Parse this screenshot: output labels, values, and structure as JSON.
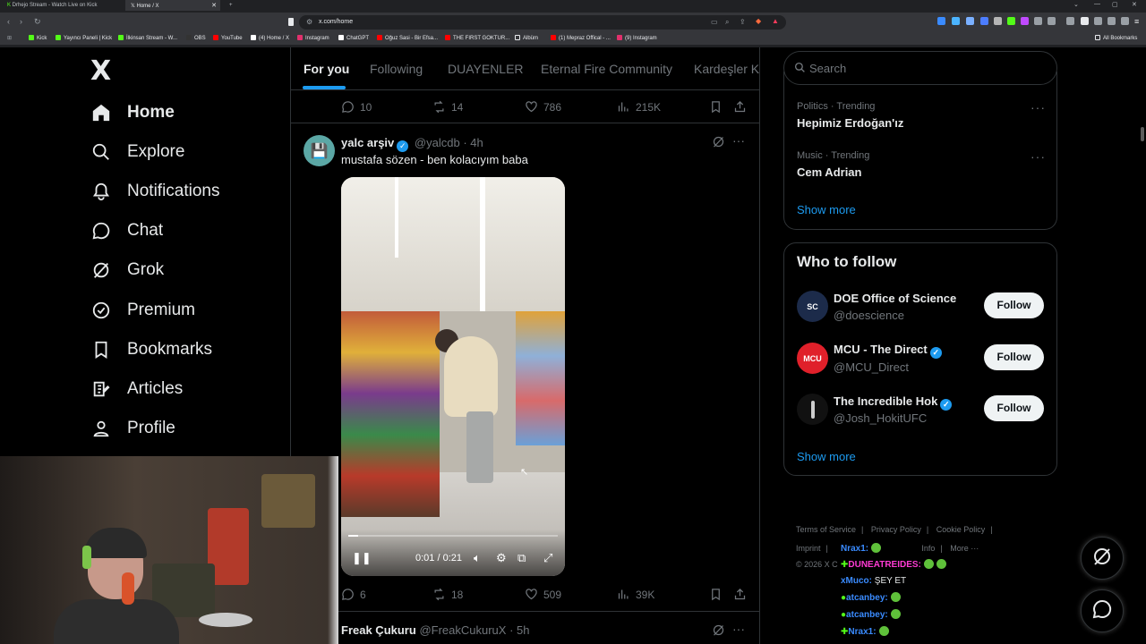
{
  "browser": {
    "tabs": [
      {
        "title": "Drhejo Stream - Watch Live on Kick"
      },
      {
        "title": "Home / X",
        "active": true
      }
    ],
    "url": "x.com/home",
    "bookmarks": [
      "Kick",
      "Yayıncı Paneli | Kick",
      "İlkinsan Stream - W...",
      "OBS",
      "YouTube",
      "(4) Home / X",
      "Instagram",
      "ChatGPT",
      "Oğuz Sasi - Bir Efsa...",
      "THE FIRST GOKTUR...",
      "Albüm",
      "(1) Mepraz Offical - ...",
      "(9) Instagram"
    ],
    "all_bookmarks": "All Bookmarks"
  },
  "sidebar": {
    "logo": "X",
    "items": [
      {
        "label": "Home",
        "icon": "home-icon",
        "bold": true
      },
      {
        "label": "Explore",
        "icon": "search-icon"
      },
      {
        "label": "Notifications",
        "icon": "bell-icon"
      },
      {
        "label": "Chat",
        "icon": "chat-bubble-icon"
      },
      {
        "label": "Grok",
        "icon": "grok-icon"
      },
      {
        "label": "Premium",
        "icon": "premium-badge-icon"
      },
      {
        "label": "Bookmarks",
        "icon": "bookmark-icon"
      },
      {
        "label": "Articles",
        "icon": "article-icon"
      },
      {
        "label": "Profile",
        "icon": "person-icon"
      }
    ]
  },
  "feed": {
    "tabs": [
      "For you",
      "Following",
      "DUAYENLER",
      "Eternal Fire Community",
      "Kardeşler Ku"
    ],
    "prev_post_stats": {
      "replies": "10",
      "reposts": "14",
      "likes": "786",
      "views": "215K"
    },
    "post": {
      "name": "yalc arşiv",
      "handle": "@yalcdb",
      "time": "4h",
      "text": "mustafa sözen - ben kolacıyım baba",
      "video_time": "0:01 / 0:21",
      "video_progress": 0.048,
      "stats": {
        "replies": "6",
        "reposts": "18",
        "likes": "509",
        "views": "39K"
      }
    },
    "next_post": {
      "name": "Freak Çukuru",
      "handle": "@FreakCukuruX",
      "time": "5h"
    }
  },
  "right": {
    "search_placeholder": "Search",
    "trends": [
      {
        "category": "Politics · Trending",
        "title": "Hepimiz Erdoğan'ız"
      },
      {
        "category": "Music · Trending",
        "title": "Cem Adrian"
      }
    ],
    "show_more": "Show more",
    "who_to_follow": {
      "title": "Who to follow",
      "accounts": [
        {
          "name": "DOE Office of Science",
          "handle": "@doescience",
          "avatar_text": "SC",
          "verified": false,
          "color": "#1c2b4a"
        },
        {
          "name": "MCU - The Direct",
          "handle": "@MCU_Direct",
          "avatar_text": "MCU",
          "verified": true,
          "color": "#e0202a"
        },
        {
          "name": "The Incredible Hok",
          "handle": "@Josh_HokitUFC",
          "avatar_text": "",
          "verified": true,
          "color": "#111111"
        }
      ],
      "follow_label": "Follow",
      "show_more": "Show more"
    },
    "footer": {
      "links": [
        "Terms of Service",
        "Privacy Policy",
        "Cookie Policy",
        "Imprint",
        "Info",
        "More ···"
      ],
      "copyright": "© 2026 X C"
    }
  },
  "stream_chat": [
    {
      "user": "Nrax1:",
      "text": "",
      "color": "#3a8bff"
    },
    {
      "user": "DUNEATREIDES:",
      "text": "",
      "color": "#ff3bd4"
    },
    {
      "user": "xMuco:",
      "text": "ŞEY ET",
      "color": "#3a8bff"
    },
    {
      "user": "atcanbey:",
      "text": "",
      "color": "#3a8bff"
    },
    {
      "user": "atcanbey:",
      "text": "",
      "color": "#3a8bff"
    },
    {
      "user": "Nrax1:",
      "text": "",
      "color": "#3a8bff"
    }
  ]
}
